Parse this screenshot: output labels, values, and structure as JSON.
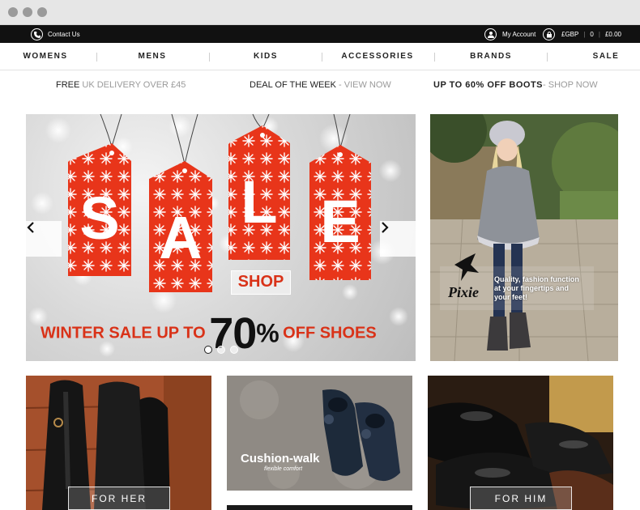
{
  "topbar": {
    "contact_label": "Contact Us",
    "account_label": "My Account",
    "currency": "£GBP",
    "basket_count": "0",
    "basket_total": "£0.00"
  },
  "nav": {
    "items": [
      "WOMENS",
      "MENS",
      "KIDS",
      "ACCESSORIES",
      "BRANDS",
      "SALE"
    ]
  },
  "promo": {
    "delivery_bold": "FREE",
    "delivery_light": "UK DELIVERY OVER £45",
    "deal_dark": "DEAL OF THE WEEK",
    "deal_light": "- VIEW NOW",
    "boots_bold": "UP TO 60% OFF BOOTS",
    "boots_light": "- SHOP NOW"
  },
  "hero": {
    "letters": [
      "S",
      "A",
      "L",
      "E"
    ],
    "shop_label": "SHOP",
    "headline_prefix": "WINTER SALE UP TO",
    "headline_number": "70",
    "headline_percent": "%",
    "headline_suffix": "OFF SHOES",
    "slide_count": 3,
    "active_slide": 1,
    "accent_color": "#d93218"
  },
  "side_banner": {
    "brand": "Pixie",
    "tagline": "Quality, fashion function at your fingertips and your feet!"
  },
  "tiles": [
    {
      "label": "FOR HER"
    },
    {
      "brand": "Cushion-walk",
      "brand_sub": "flexible comfort"
    },
    {
      "label": "FOR HIM"
    }
  ]
}
